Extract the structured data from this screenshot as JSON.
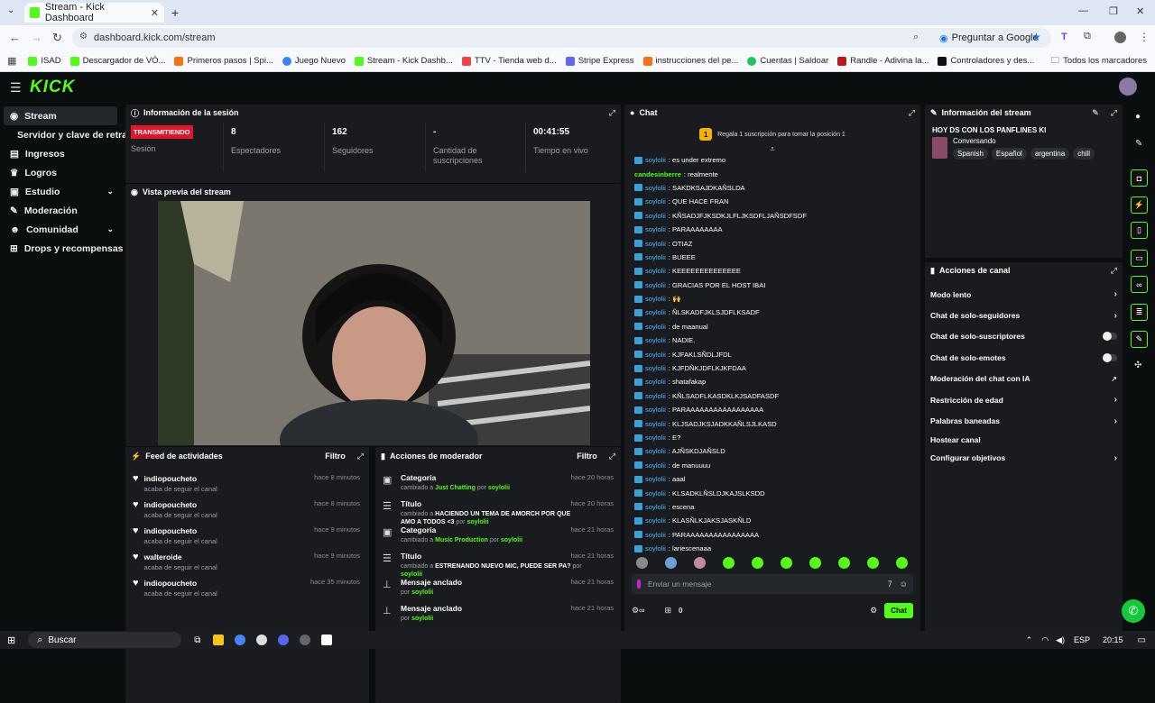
{
  "browser": {
    "tab_title": "Stream - Kick Dashboard",
    "url": "dashboard.kick.com/stream",
    "ask_google": "Preguntar a Google",
    "bookmarks": [
      {
        "label": "ISAD",
        "color": "#53fc18"
      },
      {
        "label": "Descargador de VÓ...",
        "color": "#53fc18"
      },
      {
        "label": "Primeros pasos | Spi...",
        "color": "#f97316"
      },
      {
        "label": "Juego Nuevo",
        "color": "#3b82f6"
      },
      {
        "label": "Stream - Kick Dashb...",
        "color": "#53fc18"
      },
      {
        "label": "TTV - Tienda web d...",
        "color": "#ef4444"
      },
      {
        "label": "Stripe Express",
        "color": "#6366f1"
      },
      {
        "label": "instrucciones del pe...",
        "color": "#f97316"
      },
      {
        "label": "Cuentas | Saldoar",
        "color": "#22c55e"
      },
      {
        "label": "Randle - Adivina la...",
        "color": "#b91c1c"
      },
      {
        "label": "Controladores y des...",
        "color": "#111111"
      }
    ],
    "all_bookmarks": "Todos los marcadores"
  },
  "sidebar": {
    "items": [
      {
        "label": "Stream",
        "icon": "broadcast-icon"
      },
      {
        "label": "Servidor y clave de retransmisión",
        "icon": ""
      },
      {
        "label": "Ingresos",
        "icon": "wallet-icon"
      },
      {
        "label": "Logros",
        "icon": "trophy-icon"
      },
      {
        "label": "Estudio",
        "icon": "studio-icon"
      },
      {
        "label": "Moderación",
        "icon": "wrench-icon"
      },
      {
        "label": "Comunidad",
        "icon": "community-icon"
      },
      {
        "label": "Drops y recompensas",
        "icon": "gift-icon"
      }
    ]
  },
  "session": {
    "title": "Información de la sesión",
    "status": "TRANSMITIENDO",
    "status_label": "Sesión",
    "viewers": "8",
    "viewers_label": "Espectadores",
    "followers": "162",
    "followers_label": "Seguidores",
    "subs": "-",
    "subs_label": "Cantidad de suscripciones",
    "time": "00:41:55",
    "time_label": "Tiempo en vivo"
  },
  "preview": {
    "title": "Vista previa del stream"
  },
  "feed": {
    "title": "Feed de actividades",
    "filter": "Filtro",
    "items": [
      {
        "name": "indiopoucheto",
        "sub": "acaba de seguir el canal",
        "time": "hace 8 minutos"
      },
      {
        "name": "indiopoucheto",
        "sub": "acaba de seguir el canal",
        "time": "hace 8 minutos"
      },
      {
        "name": "indiopoucheto",
        "sub": "acaba de seguir el canal",
        "time": "hace 9 minutos"
      },
      {
        "name": "walteroide",
        "sub": "acaba de seguir el canal",
        "time": "hace 9 minutos"
      },
      {
        "name": "indiopoucheto",
        "sub": "acaba de seguir el canal",
        "time": "hace 35 minutos"
      }
    ]
  },
  "mod": {
    "title": "Acciones de moderador",
    "filter": "Filtro",
    "items": [
      {
        "icon": "category-icon",
        "title": "Categoría",
        "pre": "cambiado a ",
        "val": "Just Chatting",
        "by": " por ",
        "user": "soylolii",
        "time": "hace 20 horas"
      },
      {
        "icon": "title-icon",
        "title": "Título",
        "pre": "cambiado a ",
        "val": "HACIENDO UN TEMA DE AMORCH POR QUE AMO A TODOS <3",
        "by": " por ",
        "user": "soylolii",
        "time": "hace 20 horas"
      },
      {
        "icon": "category-icon",
        "title": "Categoría",
        "pre": "cambiado a ",
        "val": "Music Production",
        "by": " por ",
        "user": "soylolii",
        "time": "hace 21 horas"
      },
      {
        "icon": "title-icon",
        "title": "Título",
        "pre": "cambiado a ",
        "val": "ESTRENANDO NUEVO MIC, PUEDE SER PA?",
        "by": " por ",
        "user": "soylolii",
        "time": "hace 21 horas"
      },
      {
        "icon": "pin-icon",
        "title": "Mensaje anclado",
        "pre": "",
        "val": "",
        "by": "por ",
        "user": "soylolii",
        "time": "hace 21 horas"
      },
      {
        "icon": "pin-icon",
        "title": "Mensaje anclado",
        "pre": "",
        "val": "",
        "by": "por ",
        "user": "soylolii",
        "time": "hace 21 horas"
      }
    ]
  },
  "chat": {
    "title": "Chat",
    "gift_text": "Regala 1 suscripción para tomar la posición 1",
    "messages": [
      {
        "user": "soylolii",
        "text": ": es under extremo",
        "badge": true
      },
      {
        "user": "candesinberre",
        "text": ": realmente",
        "badge": false
      },
      {
        "user": "soylolii",
        "text": ": SAKDKSAJDKAÑSLDA",
        "badge": true
      },
      {
        "user": "soylolii",
        "text": ": QUE HACE FRAN",
        "badge": true
      },
      {
        "user": "soylolii",
        "text": ": KÑSADJFJKSDKJLFLJKSDFLJAÑSDFSDF",
        "badge": true
      },
      {
        "user": "soylolii",
        "text": ": PARAAAAAAAA",
        "badge": true
      },
      {
        "user": "soylolii",
        "text": ": OTIAZ",
        "badge": true
      },
      {
        "user": "soylolii",
        "text": ": BUEEE",
        "badge": true
      },
      {
        "user": "soylolii",
        "text": ": KEEEEEEEEEEEEEE",
        "badge": true
      },
      {
        "user": "soylolii",
        "text": ": GRACIAS POR EL HOST IBAI",
        "badge": true
      },
      {
        "user": "soylolii",
        "text": ": 🙌",
        "badge": true
      },
      {
        "user": "soylolii",
        "text": ": ÑLSKADFJKLSJDFLKSADF",
        "badge": true
      },
      {
        "user": "soylolii",
        "text": ": de maanual",
        "badge": true
      },
      {
        "user": "soylolii",
        "text": ": NADIE.",
        "badge": true
      },
      {
        "user": "soylolii",
        "text": ": KJFAKLSÑDLJFDL",
        "badge": true
      },
      {
        "user": "soylolii",
        "text": ": KJFDÑKJDFLKJKFDAA",
        "badge": true
      },
      {
        "user": "soylolii",
        "text": ": shatafakap",
        "badge": true
      },
      {
        "user": "soylolii",
        "text": ": KÑLSADFLKASDKLKJSADFASDF",
        "badge": true
      },
      {
        "user": "soylolii",
        "text": ": PARAAAAAAAAAAAAAAAAA",
        "badge": true
      },
      {
        "user": "soylolii",
        "text": ": KLJSADJKSJADKKAÑLSJLKASD",
        "badge": true
      },
      {
        "user": "soylolii",
        "text": ": E?",
        "badge": true
      },
      {
        "user": "soylolii",
        "text": ": AJÑSKDJAÑSLD",
        "badge": true
      },
      {
        "user": "soylolii",
        "text": ": de manuuuu",
        "badge": true
      },
      {
        "user": "soylolii",
        "text": ": aaal",
        "badge": true
      },
      {
        "user": "soylolii",
        "text": ": KLSADKLÑSLDJKAJSLKSDD",
        "badge": true
      },
      {
        "user": "soylolii",
        "text": ": escena",
        "badge": true
      },
      {
        "user": "soylolii",
        "text": ": KLASÑLKJAKSJASKÑLD",
        "badge": true
      },
      {
        "user": "soylolii",
        "text": ": PARAAAAAAAAAAAAAAAA",
        "badge": true
      },
      {
        "user": "soylolii",
        "text": ": lariescenaaa",
        "badge": true
      }
    ],
    "input_placeholder": "Enviar un mensaje",
    "points": "0",
    "send": "Chat"
  },
  "stream_info": {
    "title": "Información del stream",
    "stream_title": "HOY DS CON LOS PANFLINES KI",
    "category": "Conversando",
    "tags": [
      "Spanish",
      "Español",
      "argentina",
      "chill"
    ]
  },
  "channel_actions": {
    "title": "Acciones de canal",
    "items": [
      {
        "label": "Modo lento",
        "control": "arrow"
      },
      {
        "label": "Chat de solo-seguidores",
        "control": "arrow"
      },
      {
        "label": "Chat de solo-suscriptores",
        "control": "toggle"
      },
      {
        "label": "Chat de solo-emotes",
        "control": "toggle"
      },
      {
        "label": "Moderación del chat con IA",
        "control": "link"
      },
      {
        "label": "Restricción de edad",
        "control": "arrow"
      },
      {
        "label": "Palabras baneadas",
        "control": "arrow"
      },
      {
        "label": "Hostear canal",
        "control": "none"
      },
      {
        "label": "Configurar objetivos",
        "control": "arrow"
      }
    ]
  },
  "taskbar": {
    "search": "Buscar",
    "lang": "ESP",
    "time": "20:15"
  }
}
